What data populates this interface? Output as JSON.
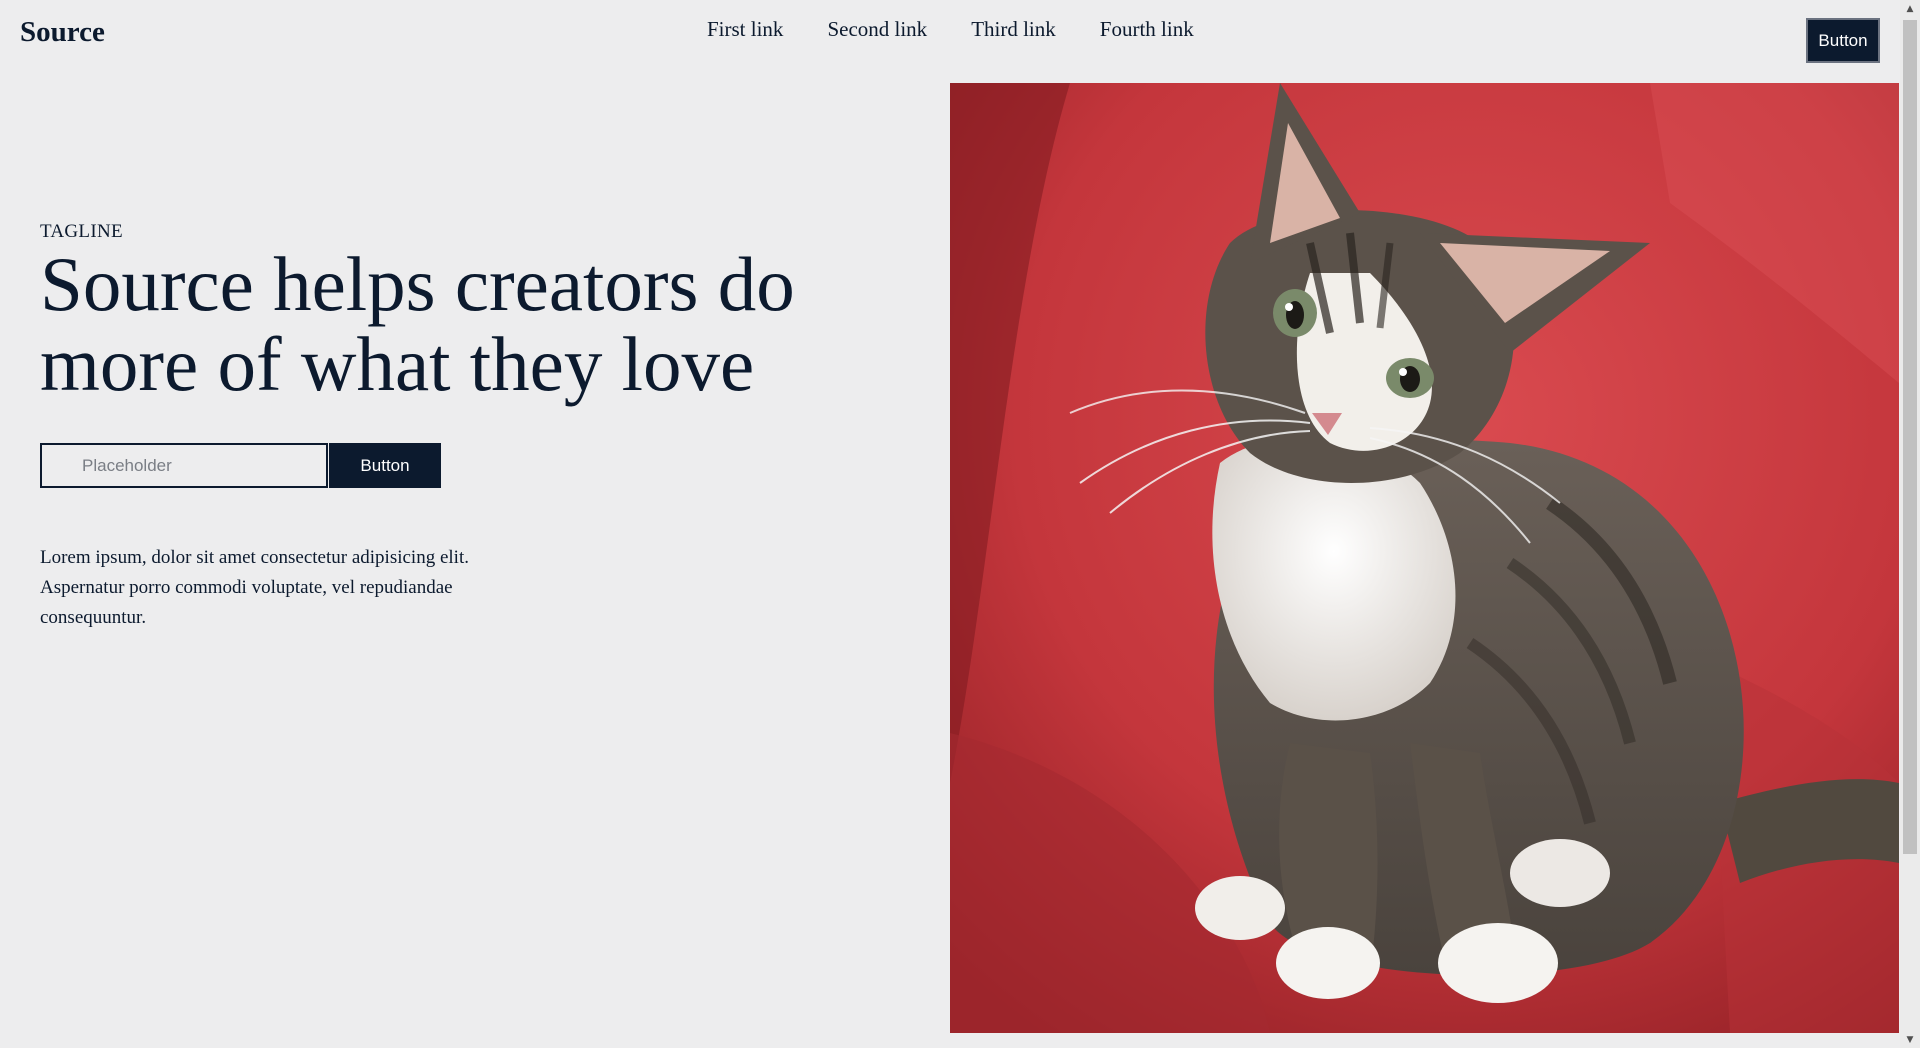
{
  "header": {
    "brand": "Source",
    "nav_links": [
      "First link",
      "Second link",
      "Third link",
      "Fourth link"
    ],
    "cta_label": "Button"
  },
  "hero": {
    "tagline": "TAGLINE",
    "headline": "Source helps creators do more of what they love",
    "input_placeholder": "Placeholder",
    "submit_label": "Button",
    "description": "Lorem ipsum, dolor sit amet consectetur adipisicing elit. Aspernatur porro commodi voluptate, vel repudiandae consequuntur.",
    "image_icon": "kitten-photo"
  },
  "colors": {
    "navy": "#0c1a2e",
    "background": "#ededee",
    "photo_red": "#c73a3f"
  }
}
